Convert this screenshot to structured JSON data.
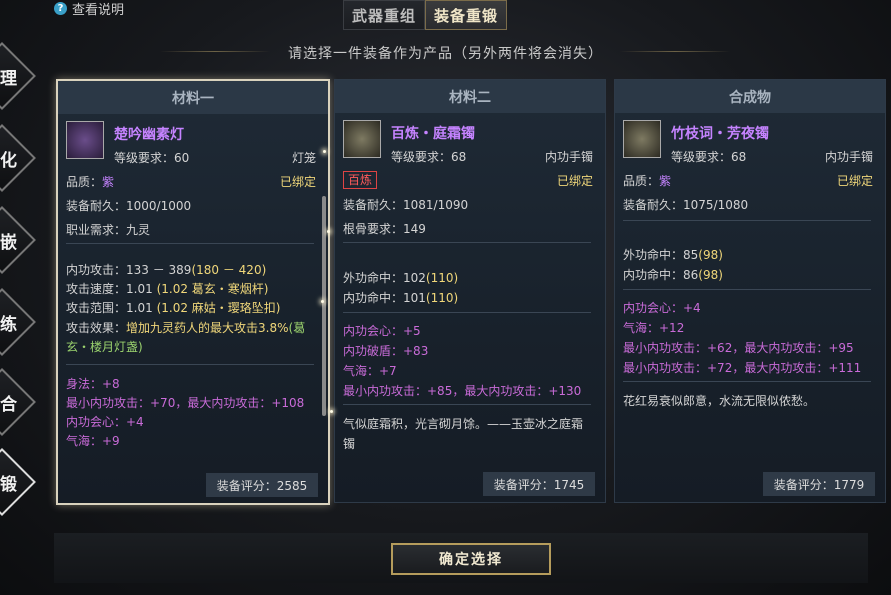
{
  "help": {
    "label": "查看说明"
  },
  "tabs": [
    {
      "label": "武器重组"
    },
    {
      "label": "装备重锻"
    }
  ],
  "instruction": "请选择一件装备作为产品（另外两件将会消失）",
  "side_nav": [
    "理",
    "化",
    "嵌",
    "练",
    "合",
    "锻"
  ],
  "panels": [
    {
      "header": "材料一",
      "item_name": "楚吟幽素灯",
      "level": "等级要求：60",
      "type": "灯笼",
      "quality_label": "品质：",
      "quality": "紫",
      "bound": "已绑定",
      "durability": "装备耐久：1000/1000",
      "requirement": "职业需求：九灵",
      "attrs": [
        "内功攻击：133 － 389",
        "攻击速度：1.01",
        "攻击范围：1.01",
        "攻击效果："
      ],
      "attr_extra": [
        "(180 － 420)",
        "(1.02 葛玄・寒烟杆)",
        "(1.02 麻姑・璎珞坠扣)"
      ],
      "effect": "增加九灵药人的最大攻击3.8%",
      "effect_src": "(葛玄・楼月灯盏)",
      "bonus": [
        "身法：+8",
        "最小内功攻击：+70，最大内功攻击：+108",
        "内功会心：+4",
        "气海：+9"
      ],
      "score": "装备评分：2585"
    },
    {
      "header": "材料二",
      "item_name": "百炼・庭霜镯",
      "level": "等级要求：68",
      "type": "内功手镯",
      "badge": "百炼",
      "bound": "已绑定",
      "durability": "装备耐久：1081/1090",
      "requirement": "根骨要求：149",
      "attrs": [
        "外功命中：102",
        "内功命中：101"
      ],
      "attr_extra": [
        "(110)",
        "(110)"
      ],
      "bonus": [
        "内功会心：+5",
        "内功破盾：+83",
        "气海：+7",
        "最小内功攻击：+85，最大内功攻击：+130"
      ],
      "desc": "气似庭霜积，光言砌月馀。——玉壶冰之庭霜镯",
      "score": "装备评分：1745"
    },
    {
      "header": "合成物",
      "item_name": "竹枝词・芳夜镯",
      "level": "等级要求：68",
      "type": "内功手镯",
      "quality_label": "品质：",
      "quality": "紫",
      "bound": "已绑定",
      "durability": "装备耐久：1075/1080",
      "attrs": [
        "外功命中：85",
        "内功命中：86"
      ],
      "attr_extra": [
        "(98)",
        "(98)"
      ],
      "bonus": [
        "内功会心：+4",
        "气海：+12",
        "最小内功攻击：+62，最大内功攻击：+95",
        "最小内功攻击：+72，最大内功攻击：+111"
      ],
      "desc": "花红易衰似郎意，水流无限似侬愁。",
      "score": "装备评分：1779"
    }
  ],
  "confirm": "确定选择"
}
